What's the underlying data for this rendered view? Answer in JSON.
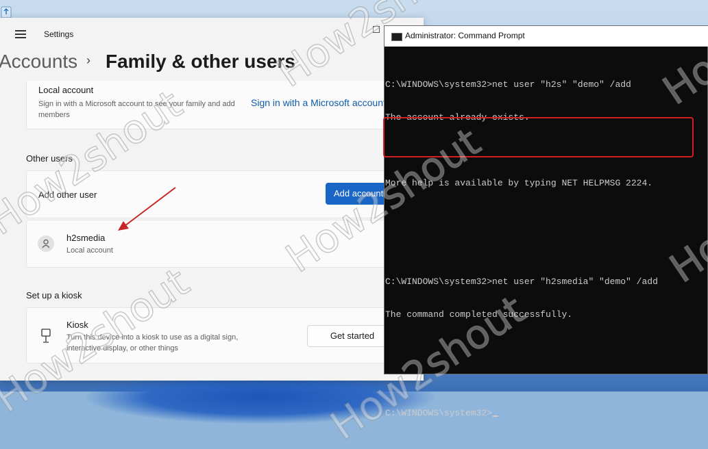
{
  "settings": {
    "app_title": "Settings",
    "breadcrumb": {
      "parent": "Accounts",
      "separator": "›",
      "current": "Family & other users"
    },
    "local_account": {
      "title": "Local account",
      "description": "Sign in with a Microsoft account to see your family and add members",
      "link": "Sign in with a Microsoft account"
    },
    "other_users": {
      "heading": "Other users",
      "add_label": "Add other user",
      "add_button": "Add account",
      "users": [
        {
          "name": "h2smedia",
          "type": "Local account"
        }
      ]
    },
    "kiosk": {
      "heading": "Set up a kiosk",
      "title": "Kiosk",
      "description": "Turn this device into a kiosk to use as a digital sign, interactive display, or other things",
      "button": "Get started"
    }
  },
  "cmd": {
    "title": "Administrator: Command Prompt",
    "lines": [
      "C:\\WINDOWS\\system32>net user \"h2s\" \"demo\" /add",
      "The account already exists.",
      "",
      "More help is available by typing NET HELPMSG 2224.",
      "",
      "",
      "C:\\WINDOWS\\system32>net user \"h2smedia\" \"demo\" /add",
      "The command completed successfully.",
      "",
      "",
      "C:\\WINDOWS\\system32>"
    ]
  },
  "watermark": "How2shout",
  "colors": {
    "accent": "#1a66c7",
    "link": "#0f5ba7",
    "highlight": "#d42020",
    "terminal_bg": "#0c0c0c"
  }
}
